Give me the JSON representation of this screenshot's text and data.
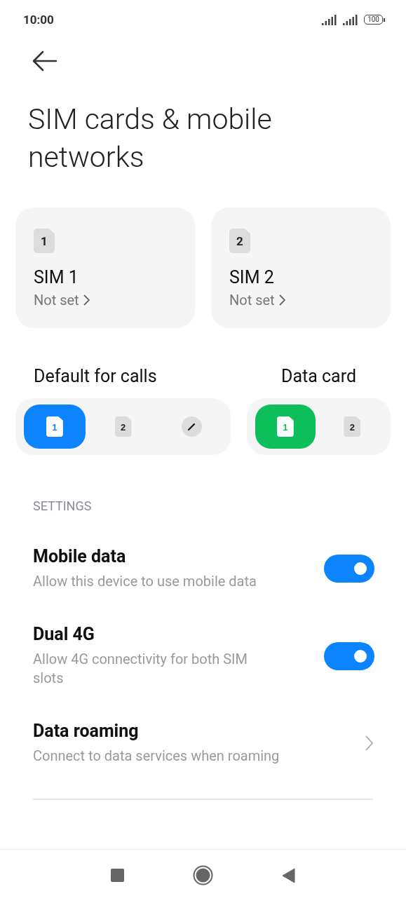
{
  "status_bar": {
    "time": "10:00",
    "battery": "100"
  },
  "title": "SIM cards & mobile networks",
  "sim_cards": [
    {
      "badge": "1",
      "name": "SIM 1",
      "status": "Not set"
    },
    {
      "badge": "2",
      "name": "SIM 2",
      "status": "Not set"
    }
  ],
  "selectors": [
    {
      "kind": "calls",
      "label": "Default for calls",
      "options": [
        {
          "kind": "sim",
          "badge": "1",
          "selected": true
        },
        {
          "kind": "sim",
          "badge": "2",
          "selected": false
        },
        {
          "kind": "edit",
          "selected": false
        }
      ]
    },
    {
      "kind": "data",
      "label": "Data card",
      "options": [
        {
          "kind": "sim",
          "badge": "1",
          "selected": true
        },
        {
          "kind": "sim",
          "badge": "2",
          "selected": false
        }
      ]
    }
  ],
  "settings": {
    "header": "SETTINGS",
    "items": [
      {
        "kind": "toggle",
        "title": "Mobile data",
        "subtitle": "Allow this device to use mobile data",
        "on": true
      },
      {
        "kind": "toggle",
        "title": "Dual 4G",
        "subtitle": "Allow 4G connectivity for both SIM slots",
        "on": true
      },
      {
        "kind": "link",
        "title": "Data roaming",
        "subtitle": "Connect to data services when roaming"
      }
    ]
  }
}
